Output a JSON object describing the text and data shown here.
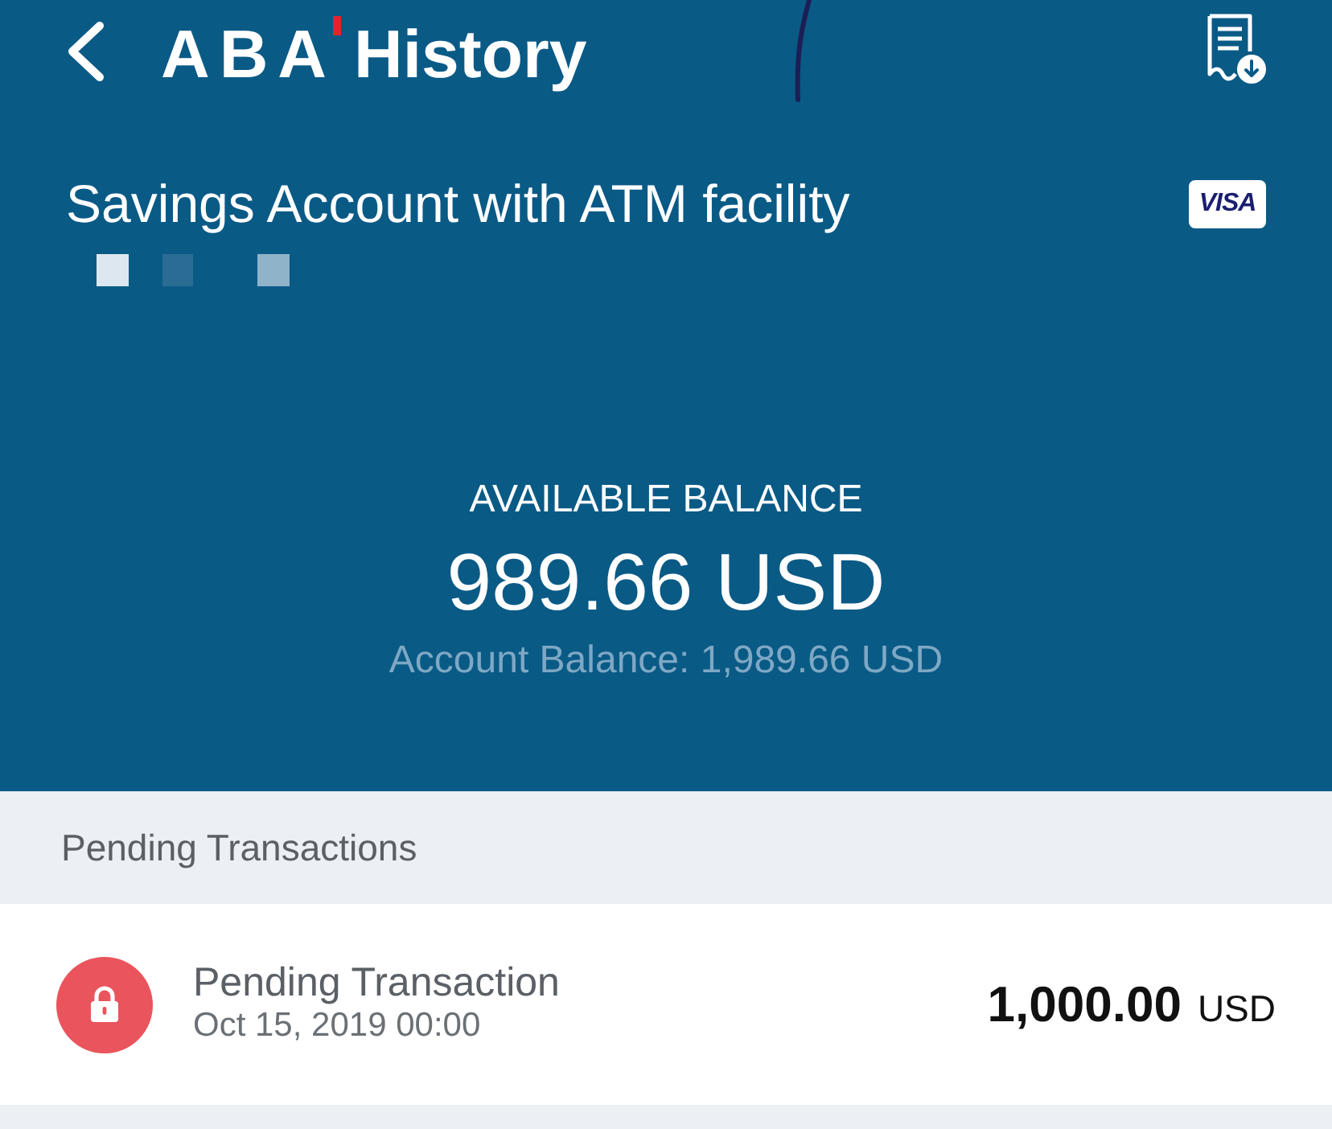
{
  "header": {
    "logo": "ABA",
    "title": "History"
  },
  "account": {
    "name": "Savings Account with ATM facility",
    "card_brand": "VISA"
  },
  "balance": {
    "label": "AVAILABLE BALANCE",
    "available": "989.66 USD",
    "account_balance": "Account Balance: 1,989.66 USD"
  },
  "pending": {
    "title": "Pending Transactions",
    "transactions": [
      {
        "title": "Pending Transaction",
        "date": "Oct 15, 2019 00:00",
        "amount": "1,000.00",
        "currency": "USD"
      }
    ]
  }
}
